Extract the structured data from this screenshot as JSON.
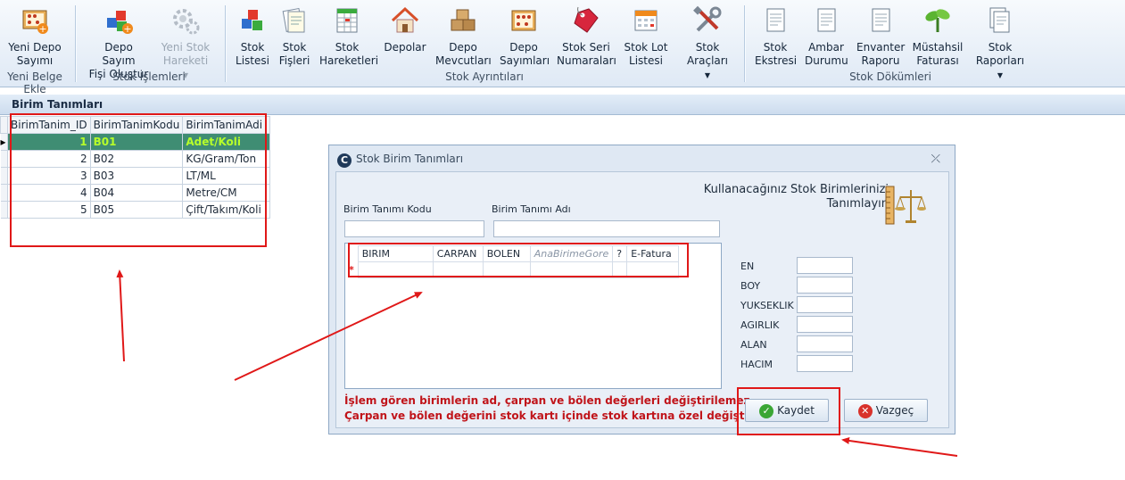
{
  "ribbon": {
    "buttons": [
      {
        "id": "yeni-depo-sayimi",
        "label": "Yeni Depo\nSayımı",
        "icon": "abacus-plus-icon"
      },
      {
        "id": "depo-sayim-fisi-olustur",
        "label": "Depo Sayım\nFişi Oluştur",
        "icon": "cubes-plus-icon"
      },
      {
        "id": "yeni-stok-hareketi",
        "label": "Yeni Stok\nHareketi",
        "icon": "gears-icon",
        "disabled": true
      },
      {
        "id": "stok-listesi",
        "label": "Stok\nListesi",
        "icon": "cubes-icon"
      },
      {
        "id": "stok-fisleri",
        "label": "Stok\nFişleri",
        "icon": "documents-icon"
      },
      {
        "id": "stok-hareketleri",
        "label": "Stok\nHareketleri",
        "icon": "spreadsheet-icon"
      },
      {
        "id": "depolar",
        "label": "Depolar",
        "icon": "house-icon"
      },
      {
        "id": "depo-mevcutlari",
        "label": "Depo\nMevcutları",
        "icon": "boxes-icon"
      },
      {
        "id": "depo-sayimlari",
        "label": "Depo\nSayımları",
        "icon": "abacus-icon"
      },
      {
        "id": "stok-seri-numaralari",
        "label": "Stok Seri\nNumaraları",
        "icon": "tag-icon"
      },
      {
        "id": "stok-lot-listesi",
        "label": "Stok Lot\nListesi",
        "icon": "calendar-icon"
      },
      {
        "id": "stok-araclari",
        "label": "Stok\nAraçları",
        "icon": "tools-icon"
      },
      {
        "id": "stok-ekstresi",
        "label": "Stok\nEkstresi",
        "icon": "report-icon"
      },
      {
        "id": "ambar-durumu",
        "label": "Ambar\nDurumu",
        "icon": "report-icon"
      },
      {
        "id": "envanter-raporu",
        "label": "Envanter\nRaporu",
        "icon": "report-icon"
      },
      {
        "id": "mustahsil-faturasi",
        "label": "Müstahsil\nFaturası",
        "icon": "plant-icon"
      },
      {
        "id": "stok-raporlari",
        "label": "Stok\nRaporları",
        "icon": "reports-icon"
      }
    ],
    "groups": {
      "yeni_belge_ekle": "Yeni Belge Ekle",
      "stok_islemleri": "Stok İşlemleri",
      "stok_ayrintilari": "Stok Ayrıntıları",
      "stok_dokumleri": "Stok Dökümleri"
    }
  },
  "panel": {
    "title": "Birim Tanımları",
    "columns": [
      "BirimTanim_ID",
      "BirimTanimKodu",
      "BirimTanimAdi"
    ],
    "rows": [
      {
        "id": "1",
        "kod": "B01",
        "adi": "Adet/Koli",
        "selected": true
      },
      {
        "id": "2",
        "kod": "B02",
        "adi": "KG/Gram/Ton"
      },
      {
        "id": "3",
        "kod": "B03",
        "adi": "LT/ML"
      },
      {
        "id": "4",
        "kod": "B04",
        "adi": "Metre/CM"
      },
      {
        "id": "5",
        "kod": "B05",
        "adi": "Çift/Takım/Koli"
      }
    ]
  },
  "dialog": {
    "title": "Stok Birim Tanımları",
    "close_glyph": "⤫",
    "fields": {
      "birim_tanimi_kodu": {
        "label": "Birim Tanımı Kodu",
        "value": ""
      },
      "birim_tanimi_adi": {
        "label": "Birim Tanımı Adı",
        "value": ""
      }
    },
    "subgrid_columns": [
      "BIRIM",
      "CARPAN",
      "BOLEN",
      "AnaBirimeGore",
      "?",
      "E-Fatura"
    ],
    "new_row_glyph": "*",
    "side_title_line1": "Kullanacağınız Stok Birimlerinizi",
    "side_title_line2": "Tanımlayın",
    "side_fields": [
      "EN",
      "BOY",
      "YUKSEKLIK",
      "AGIRLIK",
      "ALAN",
      "HACIM"
    ],
    "warning_line1": "İşlem gören birimlerin ad, çarpan ve bölen değerleri değiştirilemez.",
    "warning_line2": "Çarpan ve bölen değerini stok kartı içinde stok kartına özel değiştirebilirsiniz.",
    "save_label": "Kaydet",
    "cancel_label": "Vazgeç"
  },
  "colors": {
    "selected_row_bg": "#3f8d73",
    "selected_row_text": "#b7ff2a",
    "annotation_red": "#e01818",
    "warning_text": "#c0141a"
  }
}
